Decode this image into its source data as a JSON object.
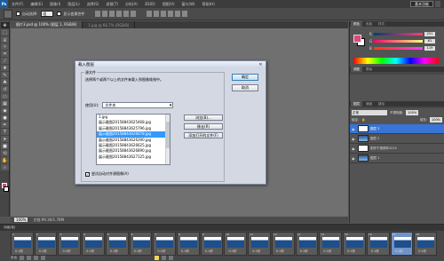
{
  "menubar": {
    "logo": "Ps",
    "items": [
      "文件(F)",
      "编辑(E)",
      "图像(I)",
      "图层(L)",
      "选择(S)",
      "滤镜(T)",
      "分析(A)",
      "3D(D)",
      "视图(V)",
      "窗口(W)",
      "帮助(H)"
    ],
    "workspace": "基本功能"
  },
  "options": {
    "auto_select_label": "自动选择:",
    "auto_select_value": "组",
    "show_transform_label": "显示变换控件"
  },
  "tabs": [
    {
      "label": "图片3.psd @ 100% (图层 1, RGB/8)"
    },
    {
      "label": "1.jpg @ 66.7% (RGB/8)"
    }
  ],
  "status": {
    "zoom": "100%",
    "doc": "文档:99.3K/1.78M"
  },
  "panels": {
    "color_tabs": [
      "颜色",
      "色板",
      "样式"
    ],
    "sliders": [
      {
        "label": "R",
        "value": "251",
        "color": "#e2467b"
      },
      {
        "label": "G",
        "value": "61",
        "color": "#3dbb5d"
      },
      {
        "label": "B",
        "value": "119",
        "color": "#4767d6"
      }
    ],
    "adjust_tabs": [
      "调整",
      "蒙版"
    ],
    "layer_tabs": [
      "图层",
      "通道",
      "路径"
    ],
    "blend_mode": "正常",
    "opacity_label": "不透明度:",
    "opacity_value": "100%",
    "lock_label": "锁定:",
    "fill_label": "填充:",
    "fill_value": "100%",
    "layers": [
      {
        "name": "图层 3",
        "selected": true,
        "thumb": "white"
      },
      {
        "name": "图层 2",
        "selected": false,
        "thumb": "blue"
      },
      {
        "name": "制作于视频年2015",
        "selected": false,
        "thumb": "white"
      },
      {
        "name": "图层 1",
        "selected": false,
        "thumb": "blue"
      }
    ]
  },
  "animation": {
    "tab": "动画(帧)",
    "frame_time": "0.1秒",
    "frames": [
      "1",
      "2",
      "3",
      "4",
      "5",
      "6",
      "7",
      "8",
      "9",
      "10",
      "11",
      "12",
      "13",
      "14",
      "15",
      "16",
      "17",
      "18"
    ],
    "selected_frame": 16,
    "loop": "永远"
  },
  "dialog": {
    "title": "载入图层",
    "group_legend": "源文件",
    "description": "选择两个或两个以上的文件来载入到图像堆栈中。",
    "use_label": "使用(U):",
    "use_value": "文件夹",
    "files": [
      "1.jpg",
      "展示截图20158843625468.jpg",
      "展示截图20158843625796.jpg",
      "展示截图20158843626078.jpg",
      "展示截图20158843626390.jpg",
      "展示截图20158843626625.jpg",
      "展示截图20158843626890.jpg",
      "展示截图20158843627125.jpg"
    ],
    "selected_file": 3,
    "browse": "浏览(B)...",
    "remove": "移去(R)",
    "add_open": "添加打开的文件(F)",
    "smart_label": "尝试自动对齐源图像(A)",
    "ok": "确定",
    "cancel": "取消"
  }
}
